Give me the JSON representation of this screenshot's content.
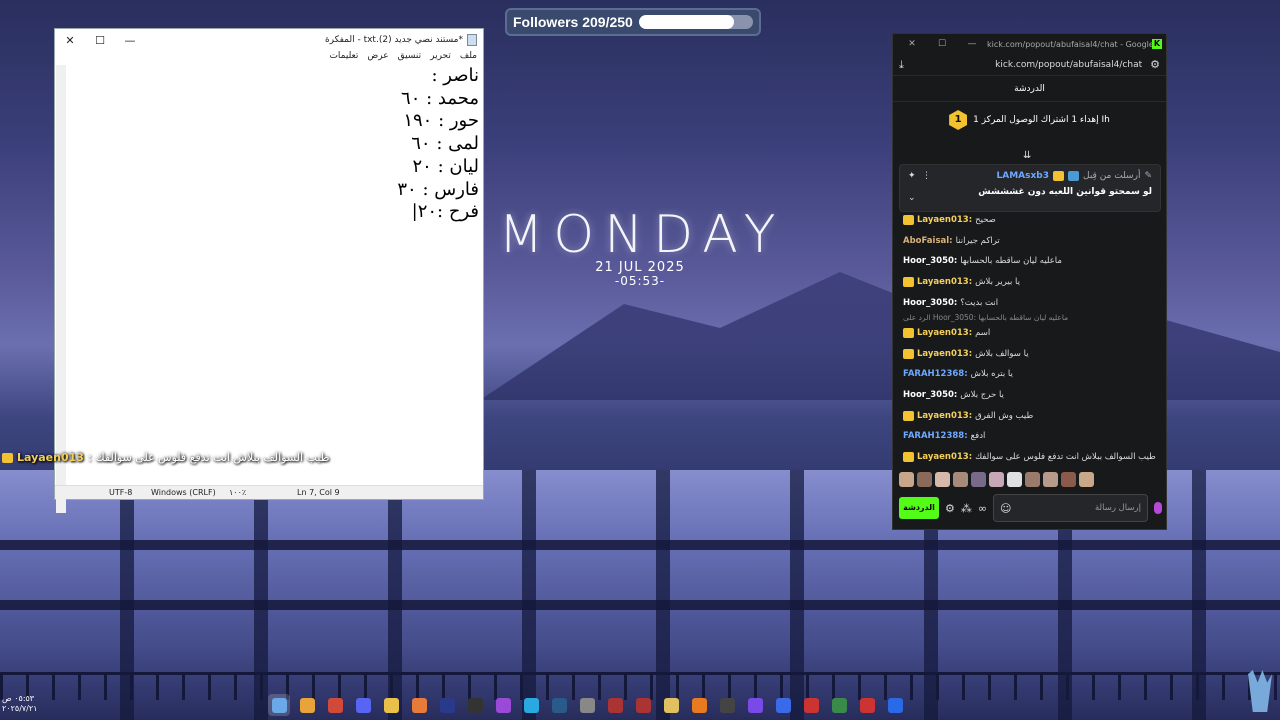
{
  "followers": {
    "label": "Followers 209/250",
    "progress": 0.836
  },
  "wallpaper": {
    "title": "MONDAY",
    "date": "21 JUL 2025",
    "time": "-05:53-"
  },
  "notepad": {
    "title": "*مستند نصي جديد (2).txt - المفكرة",
    "menu": [
      "ملف",
      "تحرير",
      "تنسيق",
      "عرض",
      "تعليمات"
    ],
    "lines": [
      "ناصر :",
      "محمد : ٦٠",
      "حور : ١٩٠",
      "لمى : ٦٠",
      "ليان : ٢٠",
      "فارس : ٣٠",
      "فرح :٢٠|"
    ],
    "status": {
      "position": "Ln 7, Col 9",
      "zoom": "١٠٠٪",
      "line_ending": "Windows (CRLF)",
      "encoding": "UTF-8"
    }
  },
  "overlay_chat": {
    "username": "Layaen013",
    "separator": ":",
    "message": "طيب السوالف ببلاش انت تدفع فلوس على سوالفك"
  },
  "kick": {
    "window_title": "kick.com/popout/abufaisal4/chat - Google C...",
    "url": "kick.com/popout/abufaisal4/chat",
    "header": "الدردشة",
    "gift": {
      "rank": "1",
      "text": "إهداء 1 اشتراك الوصول المركز 1 Ih"
    },
    "pinned": {
      "label": "أرسلت من قِبل",
      "username": "LAMAsxb3",
      "message": "لو سمحتو قوانين اللعبه دون غشششش"
    },
    "messages": [
      {
        "user": "Layaen013",
        "style": "gold",
        "badge": true,
        "text": "صحيح"
      },
      {
        "user": "AboFaisal",
        "style": "tan",
        "badge": false,
        "text": "تراكم جيراننا"
      },
      {
        "user": "Hoor_3050",
        "style": "white",
        "badge": false,
        "text": "ماعليه ليان ساقطه بالحسابها"
      },
      {
        "user": "Layaen013",
        "style": "gold",
        "badge": true,
        "text": "يا بيرير بلاش"
      },
      {
        "user": "Hoor_3050",
        "style": "white",
        "badge": false,
        "text": "انت بديت؟"
      },
      {
        "user": "Layaen013",
        "style": "gold",
        "badge": true,
        "text": "اسم"
      },
      {
        "user": "Layaen013",
        "style": "gold",
        "badge": true,
        "text": "يا سوالف بلاش"
      },
      {
        "user": "FARAH12368",
        "style": "blue",
        "badge": false,
        "text": "يا بتره بلاش"
      },
      {
        "user": "Hoor_3050",
        "style": "white",
        "badge": false,
        "text": "يا حرج بلاش"
      },
      {
        "user": "Layaen013",
        "style": "gold",
        "badge": true,
        "text": "طيب وش الفرق"
      },
      {
        "user": "FARAH12388",
        "style": "blue",
        "badge": false,
        "text": "ادفع"
      },
      {
        "user": "Layaen013",
        "style": "gold",
        "badge": true,
        "text": "طيب السوالف ببلاش انت تدفع فلوس على سوالفك"
      }
    ],
    "reply_hint": "الرد على Hoor_3050: ماعليه ليان ساقطه بالحسابها",
    "input_placeholder": "إرسال رسالة",
    "send_label": "الدردشة"
  },
  "taskbar": {
    "clock_time": "٠٥:٥٣ ص",
    "clock_date": "٢٠٢٥/٧/٢١",
    "icon_colors": [
      "#6aa8e8",
      "#e8a33a",
      "#d04a3a",
      "#5865f2",
      "#e8c04a",
      "#e87a3a",
      "#2a3a8a",
      "#333",
      "#9a4ad6",
      "#2aa8e0",
      "#2a5a8a",
      "#888",
      "#a33",
      "#a33",
      "#e0c060",
      "#e87a20",
      "#444",
      "#7a4ae8",
      "#3a6ae8",
      "#c33",
      "#3a8a4a",
      "#c33",
      "#2a6ae8"
    ]
  }
}
